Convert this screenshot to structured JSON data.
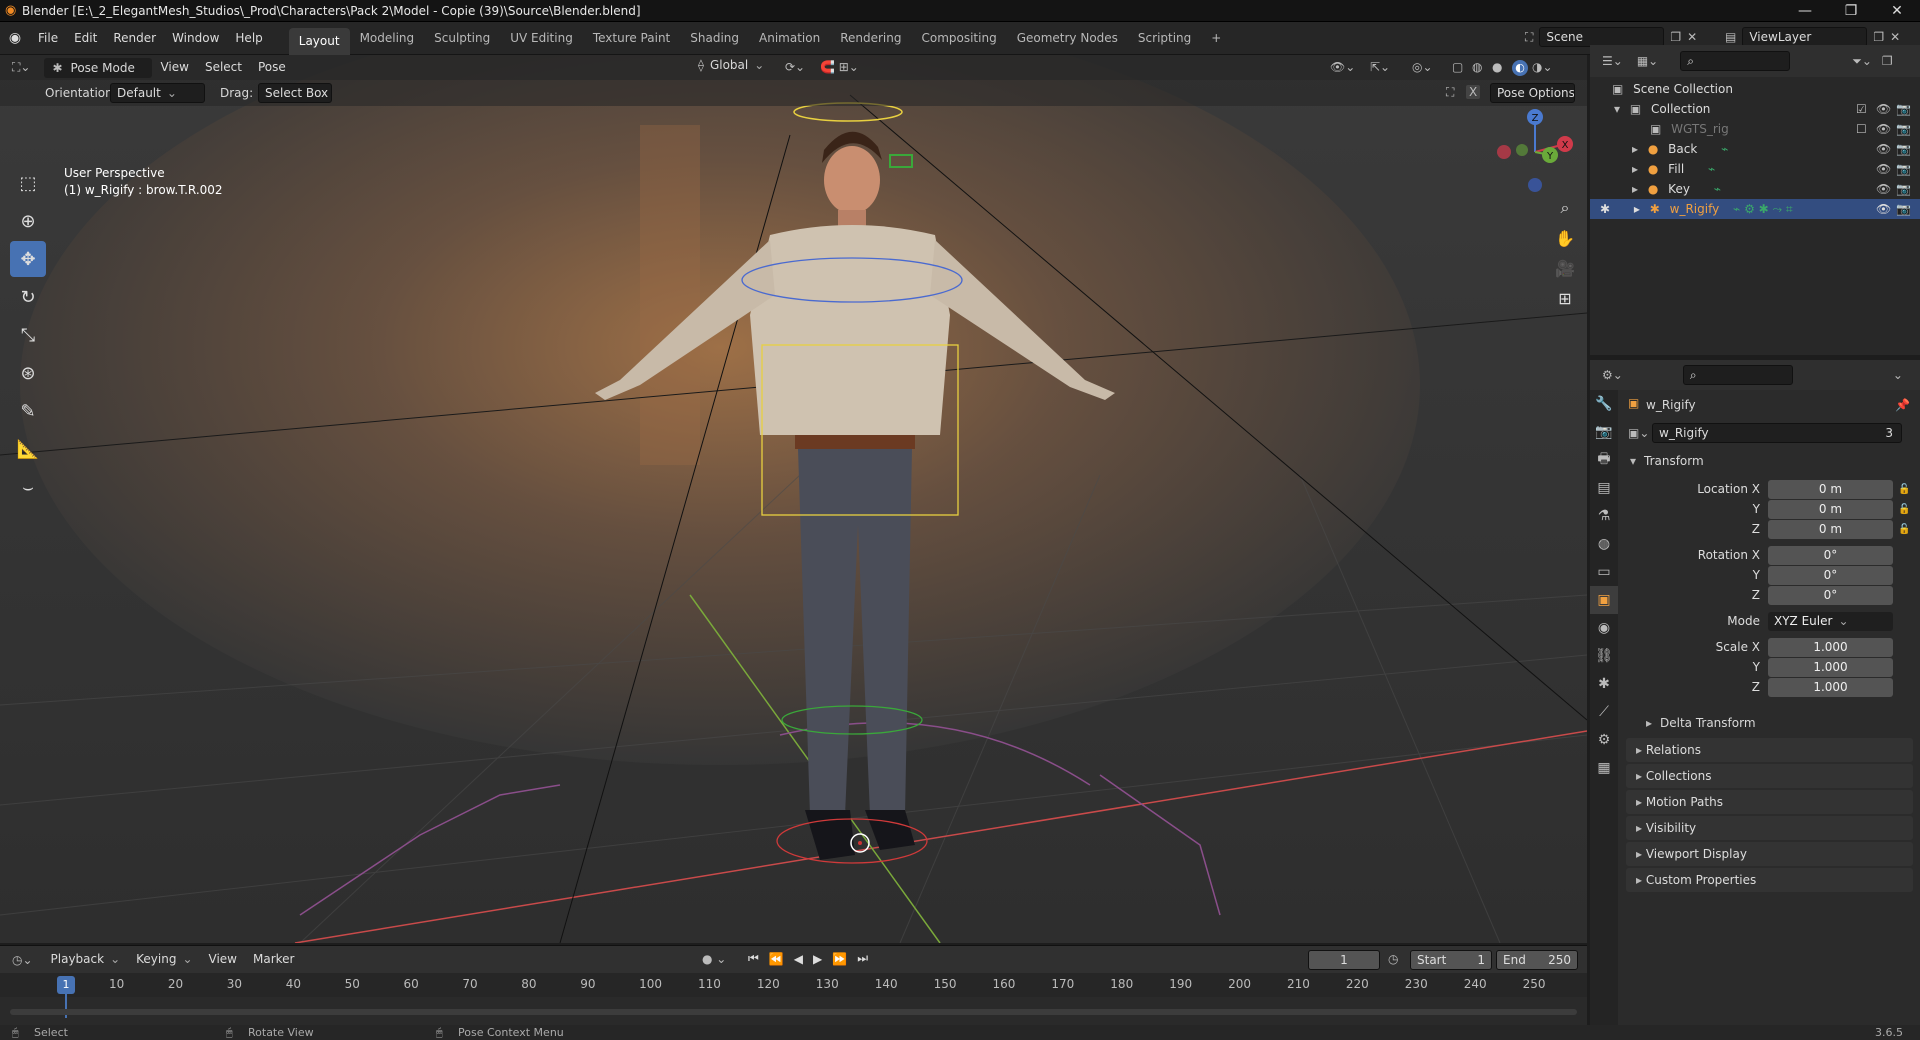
{
  "window": {
    "title": "Blender [E:\\_2_ElegantMesh_Studios\\_Prod\\Characters\\Pack 2\\Model - Copie (39)\\Source\\Blender.blend]",
    "controls": [
      "—",
      "❐",
      "✕"
    ]
  },
  "menus": [
    "File",
    "Edit",
    "Render",
    "Window",
    "Help"
  ],
  "workspaces": [
    "Layout",
    "Modeling",
    "Sculpting",
    "UV Editing",
    "Texture Paint",
    "Shading",
    "Animation",
    "Rendering",
    "Compositing",
    "Geometry Nodes",
    "Scripting"
  ],
  "active_workspace": "Layout",
  "add_workspace": "+",
  "scene": {
    "name": "Scene",
    "view_layer": "ViewLayer"
  },
  "viewport": {
    "mode": "Pose Mode",
    "menus": [
      "View",
      "Select",
      "Pose"
    ],
    "transform_orientation": "Global",
    "orientation_label": "Orientation:",
    "orientation_value": "Default",
    "drag_label": "Drag:",
    "drag_value": "Select Box",
    "pose_options": "Pose Options",
    "overlay_line1": "User Perspective",
    "overlay_line2": "(1) w_Rigify : brow.T.R.002",
    "gizmo_axes": {
      "x": "X",
      "y": "Y",
      "z": "Z"
    },
    "tools": [
      "select-box",
      "cursor",
      "move",
      "rotate",
      "scale",
      "transform",
      "annotate",
      "measure",
      "relax"
    ],
    "active_tool": "move"
  },
  "outliner": {
    "root": "Scene Collection",
    "collection": "Collection",
    "items": [
      {
        "name": "WGTS_rig",
        "dim": true
      },
      {
        "name": "Back"
      },
      {
        "name": "Fill"
      },
      {
        "name": "Key"
      },
      {
        "name": "w_Rigify",
        "selected": true
      }
    ]
  },
  "properties": {
    "object_name": "w_Rigify",
    "datablock_name": "w_Rigify",
    "datablock_users": "3",
    "transform_header": "Transform",
    "location": {
      "label_x": "Location X",
      "x": "0 m",
      "y": "0 m",
      "z": "0 m"
    },
    "rotation": {
      "label_x": "Rotation X",
      "x": "0°",
      "y": "0°",
      "z": "0°"
    },
    "mode_label": "Mode",
    "mode_value": "XYZ Euler",
    "scale": {
      "label_x": "Scale X",
      "x": "1.000",
      "y": "1.000",
      "z": "1.000"
    },
    "axis_y": "Y",
    "axis_z": "Z",
    "delta_transform": "Delta Transform",
    "panels": [
      "Relations",
      "Collections",
      "Motion Paths",
      "Visibility",
      "Viewport Display",
      "Custom Properties"
    ]
  },
  "timeline": {
    "menus": [
      "Playback",
      "Keying",
      "View",
      "Marker"
    ],
    "current_frame": "1",
    "start_label": "Start",
    "start": "1",
    "end_label": "End",
    "end": "250",
    "ruler": [
      "1",
      "10",
      "20",
      "30",
      "40",
      "50",
      "60",
      "70",
      "80",
      "90",
      "100",
      "110",
      "120",
      "130",
      "140",
      "150",
      "160",
      "170",
      "180",
      "190",
      "200",
      "210",
      "220",
      "230",
      "240",
      "250"
    ]
  },
  "status": {
    "select": "Select",
    "rotate_view": "Rotate View",
    "context_menu": "Pose Context Menu",
    "version": "3.6.5"
  },
  "colors": {
    "accent": "#4772b3",
    "selected_row": "#334d80",
    "object_orange": "#f0a040"
  }
}
